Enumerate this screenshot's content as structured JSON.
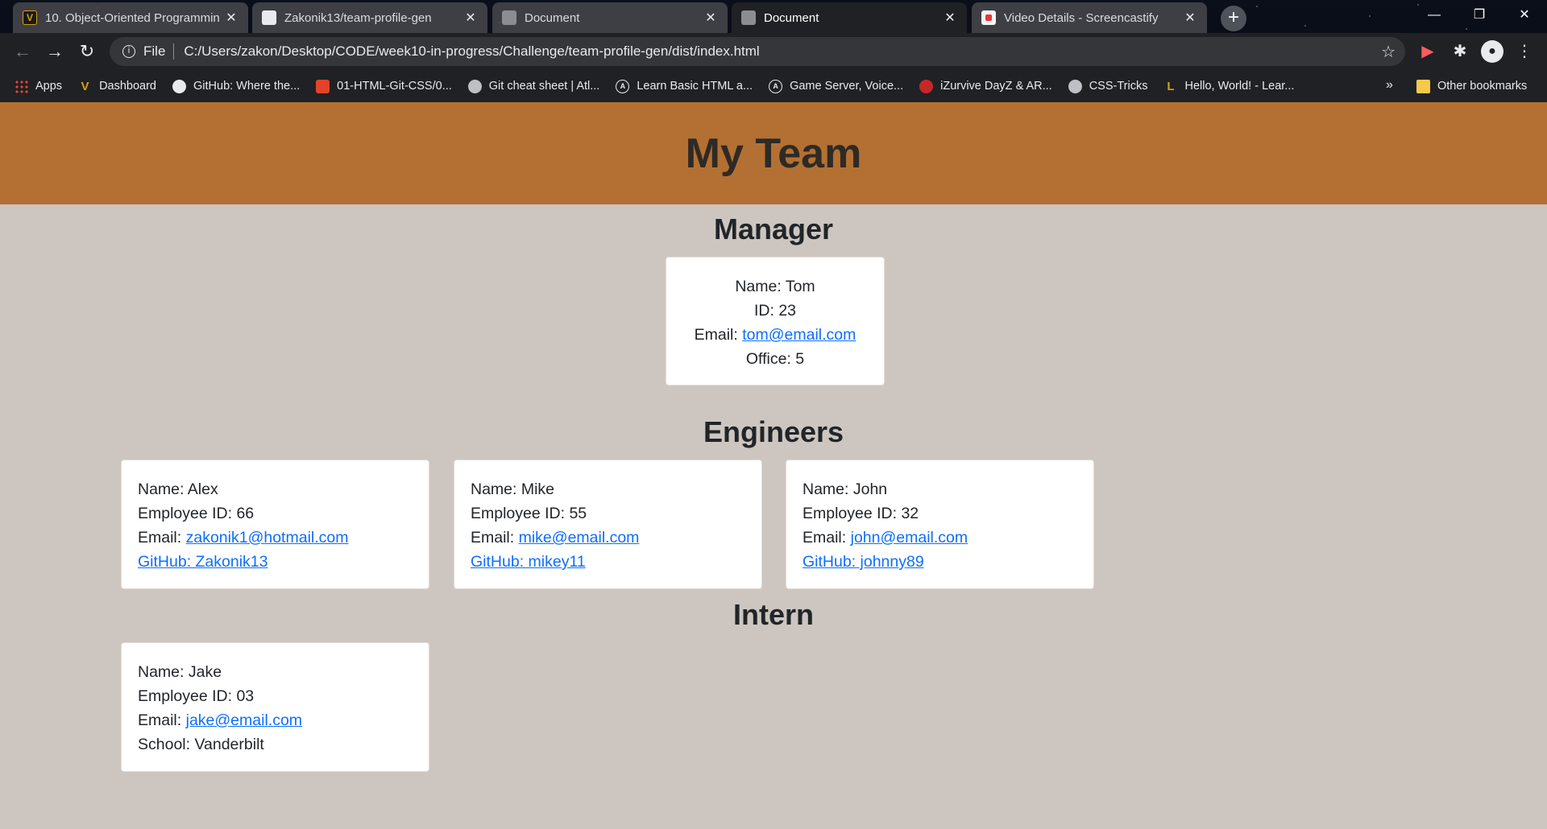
{
  "browser": {
    "tabs": [
      {
        "title": "10. Object-Oriented Programmin",
        "icon": "vanderbilt-favicon-icon",
        "state": "inactive"
      },
      {
        "title": "Zakonik13/team-profile-gen",
        "icon": "github-favicon-icon",
        "state": "inactive"
      },
      {
        "title": "Document",
        "icon": "globe-favicon-icon",
        "state": "inactive"
      },
      {
        "title": "Document",
        "icon": "globe-favicon-icon",
        "state": "active"
      },
      {
        "title": "Video Details - Screencastify",
        "icon": "screencastify-favicon-icon",
        "state": "inactive"
      }
    ],
    "omnibox": {
      "scheme_label": "File",
      "url": "C:/Users/zakon/Desktop/CODE/week10-in-progress/Challenge/team-profile-gen/dist/index.html"
    },
    "bookmarks": [
      {
        "label": "Apps",
        "icon": "apps-grid-icon"
      },
      {
        "label": "Dashboard",
        "icon": "vanderbilt-icon"
      },
      {
        "label": "GitHub: Where the...",
        "icon": "github-icon"
      },
      {
        "label": "01-HTML-Git-CSS/0...",
        "icon": "gitlab-icon"
      },
      {
        "label": "Git cheat sheet | Atl...",
        "icon": "globe-icon"
      },
      {
        "label": "Learn Basic HTML a...",
        "icon": "a-icon"
      },
      {
        "label": "Game Server, Voice...",
        "icon": "a-icon"
      },
      {
        "label": "iZurvive DayZ & AR...",
        "icon": "izurvive-icon"
      },
      {
        "label": "CSS-Tricks",
        "icon": "globe-icon"
      },
      {
        "label": "Hello, World! - Lear...",
        "icon": "l-icon"
      }
    ],
    "bookmarks_more": "»",
    "other_bookmarks": "Other bookmarks"
  },
  "page": {
    "header": "My Team",
    "manager_heading": "Manager",
    "engineers_heading": "Engineers",
    "intern_heading": "Intern",
    "manager": {
      "name": "Name: Tom",
      "id": "ID: 23",
      "email_prefix": "Email: ",
      "email": "tom@email.com",
      "office": "Office: 5"
    },
    "engineers": [
      {
        "name": "Name: Alex",
        "id": "Employee ID: 66",
        "email_prefix": "Email: ",
        "email": "zakonik1@hotmail.com",
        "github": "GitHub: Zakonik13"
      },
      {
        "name": "Name: Mike",
        "id": "Employee ID: 55",
        "email_prefix": "Email: ",
        "email": "mike@email.com",
        "github": "GitHub: mikey11"
      },
      {
        "name": "Name: John",
        "id": "Employee ID: 32",
        "email_prefix": "Email: ",
        "email": "john@email.com",
        "github": "GitHub: johnny89"
      }
    ],
    "intern": {
      "name": "Name: Jake",
      "id": "Employee ID: 03",
      "email_prefix": "Email: ",
      "email": "jake@email.com",
      "school": "School: Vanderbilt"
    }
  }
}
